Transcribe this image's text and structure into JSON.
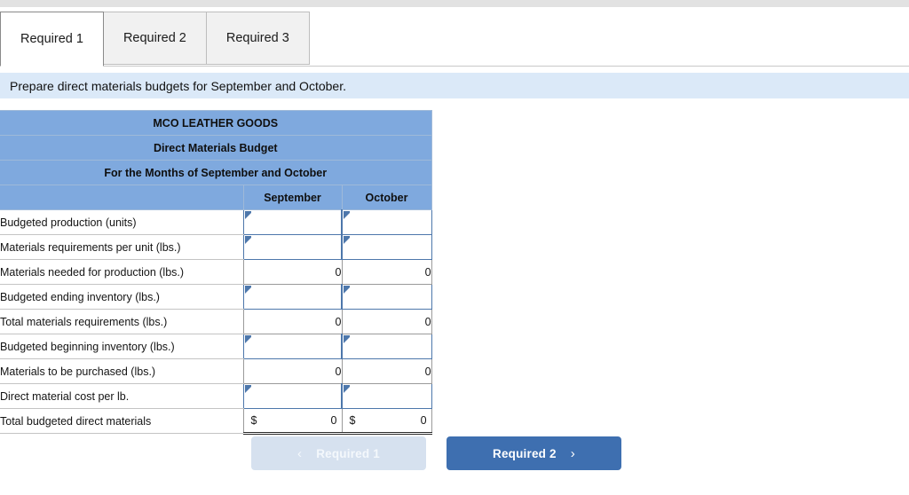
{
  "tabs": [
    {
      "label": "Required 1",
      "active": true
    },
    {
      "label": "Required 2",
      "active": false
    },
    {
      "label": "Required 3",
      "active": false
    }
  ],
  "banner": {
    "text": "Prepare direct materials budgets for September and October."
  },
  "worksheet": {
    "title_lines": [
      "MCO LEATHER GOODS",
      "Direct Materials Budget",
      "For the Months of September and October"
    ],
    "column_headers": {
      "blank": "",
      "september": "September",
      "october": "October"
    },
    "rows": [
      {
        "label": "Budgeted production (units)",
        "type": "input",
        "september": "",
        "october": ""
      },
      {
        "label": "Materials requirements per unit (lbs.)",
        "type": "input",
        "september": "",
        "october": ""
      },
      {
        "label": "Materials needed for production (lbs.)",
        "type": "calc",
        "september": "0",
        "october": "0"
      },
      {
        "label": "Budgeted ending inventory (lbs.)",
        "type": "input",
        "september": "",
        "october": ""
      },
      {
        "label": "Total materials requirements (lbs.)",
        "type": "calc",
        "september": "0",
        "october": "0"
      },
      {
        "label": "Budgeted beginning inventory (lbs.)",
        "type": "input",
        "september": "",
        "october": ""
      },
      {
        "label": "Materials to be purchased (lbs.)",
        "type": "calc",
        "september": "0",
        "october": "0"
      },
      {
        "label": "Direct material cost per lb.",
        "type": "input",
        "september": "",
        "october": ""
      },
      {
        "label": "Total budgeted direct materials",
        "type": "total",
        "currency": "$",
        "september": "0",
        "october": "0"
      }
    ]
  },
  "navigation": {
    "prev_label": "Required 1",
    "prev_icon": "chevron-left-icon",
    "prev_glyph": "‹",
    "prev_disabled": true,
    "next_label": "Required 2",
    "next_icon": "chevron-right-icon",
    "next_glyph": "›"
  },
  "colors": {
    "header_blue": "#7fa9de",
    "banner_blue": "#dbe9f8",
    "button_active": "#3e6fb0",
    "button_disabled": "#d6e1ef",
    "input_border": "#4d77ab"
  }
}
